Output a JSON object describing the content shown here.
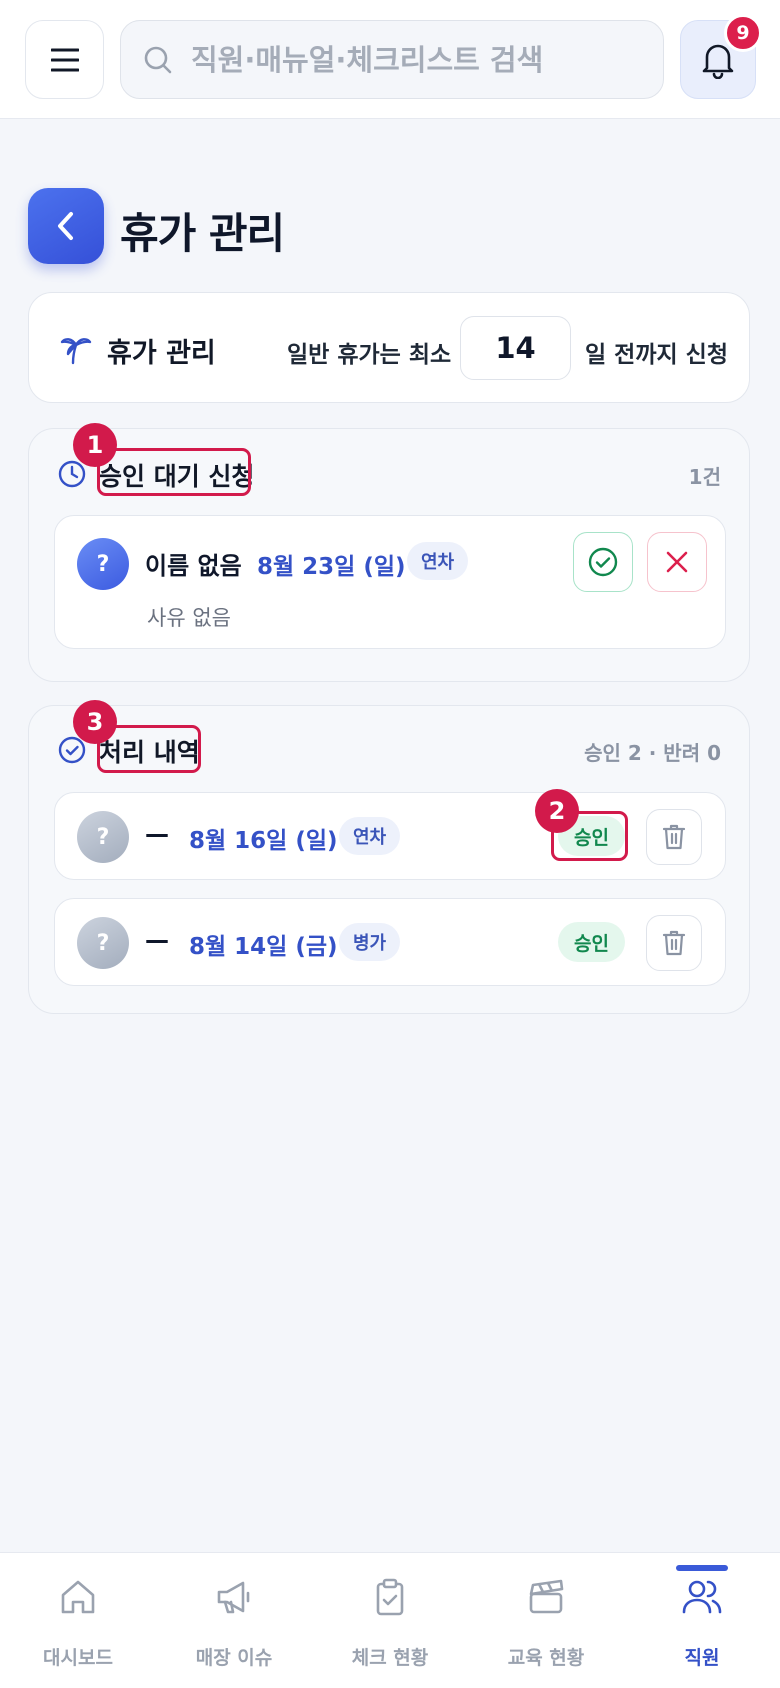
{
  "header": {
    "search_placeholder": "직원·매뉴얼·체크리스트 검색",
    "notification_count": "9"
  },
  "page": {
    "title": "휴가 관리"
  },
  "settings": {
    "title": "휴가 관리",
    "prefix": "일반 휴가는 최소",
    "min_days": "14",
    "suffix": "일 전까지 신청"
  },
  "pending": {
    "marker": "1",
    "title": "승인 대기 신청",
    "count": "1건",
    "requests": [
      {
        "avatar": "?",
        "name": "이름 없음",
        "date": "8월 23일 (일)",
        "type": "연차",
        "reason": "사유 없음"
      }
    ]
  },
  "history": {
    "marker": "3",
    "title": "처리 내역",
    "summary": "승인 2 · 반려 0",
    "status_marker": "2",
    "items": [
      {
        "avatar": "?",
        "name": "—",
        "date": "8월 16일 (일)",
        "type": "연차",
        "status": "승인"
      },
      {
        "avatar": "?",
        "name": "—",
        "date": "8월 14일 (금)",
        "type": "병가",
        "status": "승인"
      }
    ]
  },
  "nav": {
    "items": [
      {
        "label": "대시보드",
        "icon": "home-icon"
      },
      {
        "label": "매장 이슈",
        "icon": "megaphone-icon"
      },
      {
        "label": "체크 현황",
        "icon": "clipboard-check-icon"
      },
      {
        "label": "교육 현황",
        "icon": "clapperboard-icon"
      },
      {
        "label": "직원",
        "icon": "users-icon"
      }
    ],
    "active_index": 4
  },
  "colors": {
    "accent": "#3451c7",
    "approve": "#11884e",
    "reject": "#dc1f4c",
    "marker": "#d21a4b"
  }
}
